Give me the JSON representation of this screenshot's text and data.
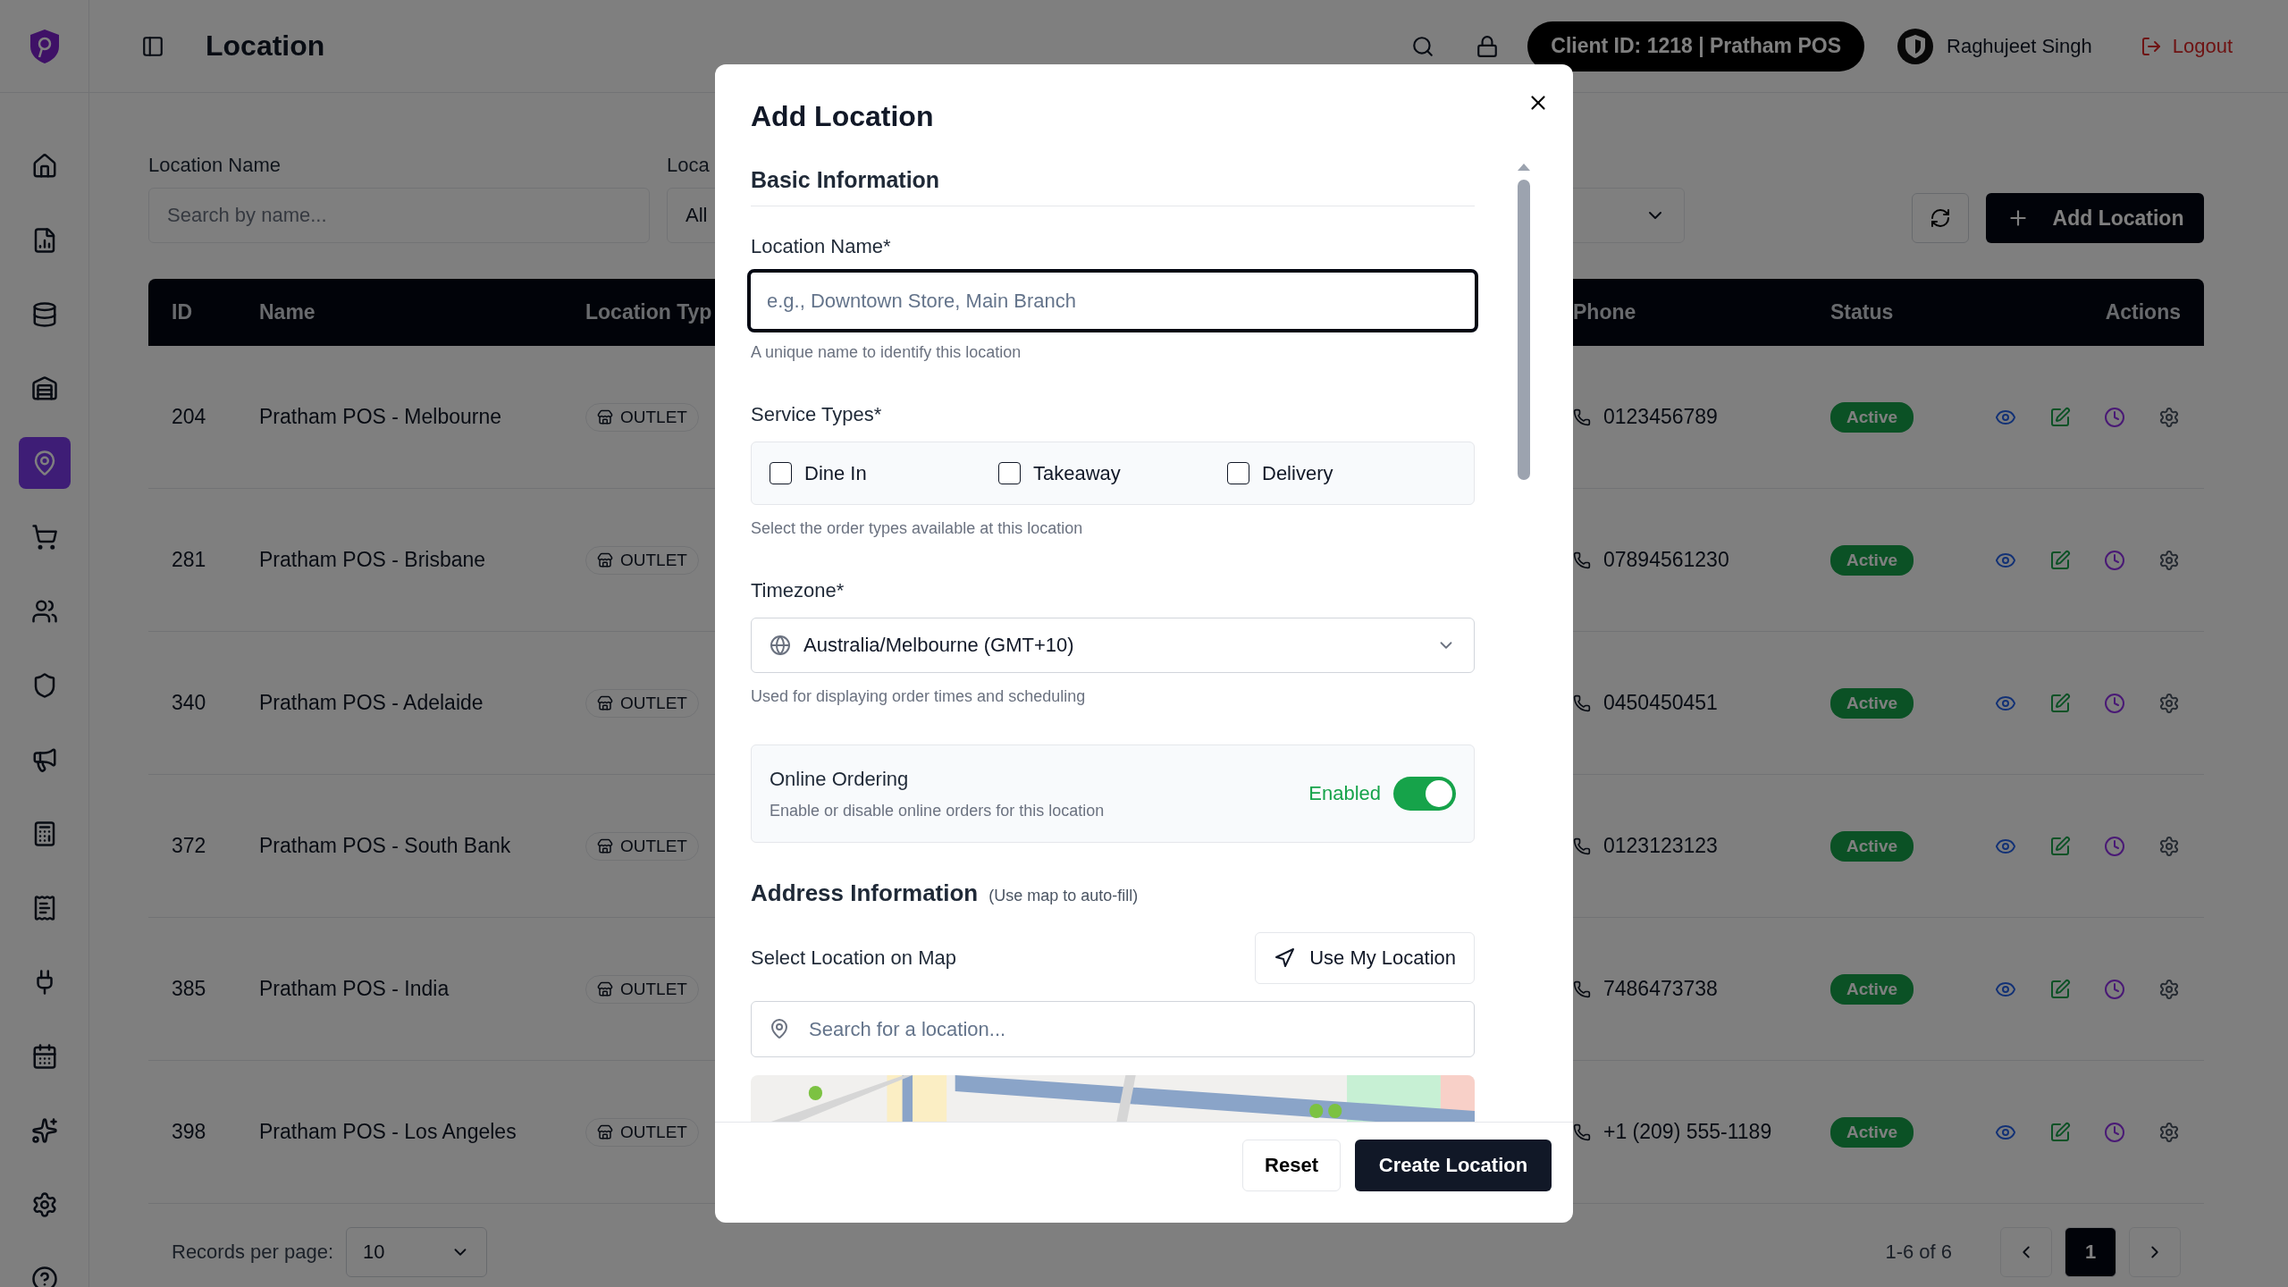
{
  "header": {
    "title": "Location",
    "client_badge": "Client ID: 1218 | Pratham POS",
    "user_name": "Raghujeet Singh",
    "logout": "Logout"
  },
  "sidebar": {
    "items": [
      {
        "selected": false
      },
      {
        "selected": false
      },
      {
        "selected": false
      },
      {
        "selected": false
      },
      {
        "selected": true
      },
      {
        "selected": false
      },
      {
        "selected": false
      },
      {
        "selected": false
      },
      {
        "selected": false
      },
      {
        "selected": false
      },
      {
        "selected": false
      },
      {
        "selected": false
      },
      {
        "selected": false
      },
      {
        "selected": false
      },
      {
        "selected": false
      },
      {
        "selected": false
      }
    ]
  },
  "filters": {
    "name_label": "Location Name",
    "name_placeholder": "Search by name...",
    "type_label": "Loca",
    "type_value": "All"
  },
  "toolbar": {
    "add_button": "Add Location"
  },
  "table": {
    "columns": [
      "ID",
      "Name",
      "Location Typ",
      "Phone",
      "Status",
      "Actions"
    ],
    "rows": [
      {
        "id": "204",
        "name": "Pratham POS - Melbourne",
        "type": "OUTLET",
        "phone": "0123456789",
        "status": "Active"
      },
      {
        "id": "281",
        "name": "Pratham POS - Brisbane",
        "type": "OUTLET",
        "phone": "07894561230",
        "status": "Active"
      },
      {
        "id": "340",
        "name": "Pratham POS - Adelaide",
        "type": "OUTLET",
        "phone": "0450450451",
        "status": "Active"
      },
      {
        "id": "372",
        "name": "Pratham POS - South Bank",
        "type": "OUTLET",
        "phone": "0123123123",
        "status": "Active"
      },
      {
        "id": "385",
        "name": "Pratham POS - India",
        "type": "OUTLET",
        "phone": "7486473738",
        "status": "Active"
      },
      {
        "id": "398",
        "name": "Pratham POS - Los Angeles",
        "type": "OUTLET",
        "phone": "+1 (209) 555-1189",
        "status": "Active"
      }
    ]
  },
  "pagination": {
    "records_label": "Records per page:",
    "per_page": "10",
    "range": "1-6 of 6",
    "pages": [
      {
        "label": "1",
        "selected": true
      }
    ]
  },
  "dialog": {
    "title": "Add Location",
    "basic_heading": "Basic Information",
    "location_name": {
      "label": "Location Name*",
      "placeholder": "e.g., Downtown Store, Main Branch",
      "hint": "A unique name to identify this location",
      "focused": true
    },
    "service_types": {
      "label": "Service Types*",
      "options": [
        {
          "label": "Dine In",
          "checked": false
        },
        {
          "label": "Takeaway",
          "checked": false
        },
        {
          "label": "Delivery",
          "checked": false
        }
      ],
      "hint": "Select the order types available at this location"
    },
    "timezone": {
      "label": "Timezone*",
      "value": "Australia/Melbourne (GMT+10)",
      "hint": "Used for displaying order times and scheduling"
    },
    "online_ordering": {
      "title": "Online Ordering",
      "description": "Enable or disable online orders for this location",
      "status": "Enabled",
      "on": true
    },
    "address": {
      "heading": "Address Information",
      "note": "(Use map to auto-fill)",
      "map_label": "Select Location on Map",
      "use_location_button": "Use My Location",
      "search_placeholder": "Search for a location..."
    },
    "buttons": {
      "reset": "Reset",
      "create": "Create Location"
    }
  }
}
